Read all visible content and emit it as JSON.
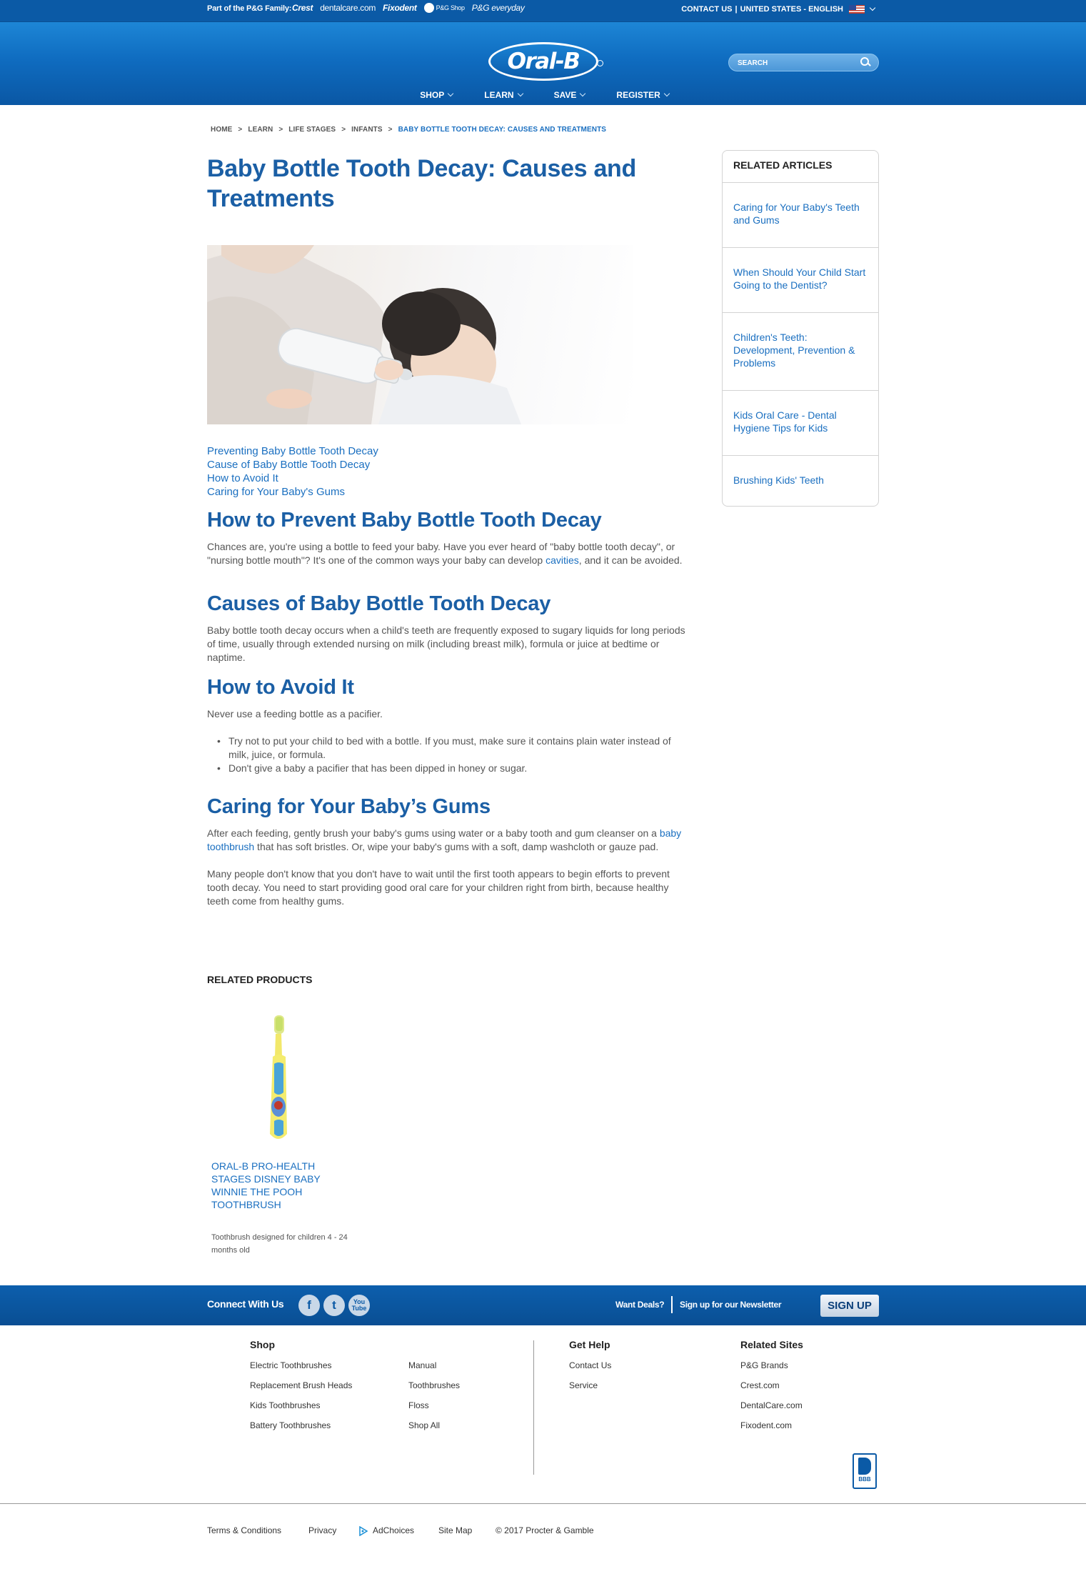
{
  "family_bar": {
    "label": "Part of the P&G Family:",
    "brands": [
      "Crest",
      "dentalcare.com",
      "Fixodent",
      "P&G Shop",
      "P&G everyday"
    ],
    "contact": "CONTACT US",
    "locale": "UNITED STATES - ENGLISH",
    "separator": "|"
  },
  "header": {
    "logo": "Oral-B",
    "search_placeholder": "SEARCH",
    "nav": [
      "SHOP",
      "LEARN",
      "SAVE",
      "REGISTER"
    ]
  },
  "breadcrumb": [
    "HOME",
    "LEARN",
    "LIFE STAGES",
    "INFANTS",
    "BABY BOTTLE TOOTH DECAY: CAUSES AND TREATMENTS"
  ],
  "breadcrumb_sep": ">",
  "article": {
    "title": "Baby Bottle Tooth Decay: Causes and Treatments",
    "toc": [
      "Preventing Baby Bottle Tooth Decay",
      "Cause of Baby Bottle Tooth Decay",
      "How to Avoid It",
      "Caring for Your Baby's Gums"
    ],
    "s1": {
      "heading": "How to Prevent Baby Bottle Tooth Decay",
      "p_before": "Chances are, you're using a bottle to feed your baby. Have you ever heard of \"baby bottle tooth decay\", or \"nursing bottle mouth\"? It's one of the common ways your baby can develop ",
      "p_link": "cavities",
      "p_after": ", and it can be avoided."
    },
    "s2": {
      "heading": "Causes of Baby Bottle Tooth Decay",
      "p": "Baby bottle tooth decay occurs when a child's teeth are frequently exposed to sugary liquids for long periods of time, usually through extended nursing on milk (including breast milk), formula or juice at bedtime or naptime."
    },
    "s3": {
      "heading": "How to Avoid It",
      "p": "Never use a feeding bottle as a pacifier.",
      "bullets": [
        "Try not to put your child to bed with a bottle. If you must, make sure it contains plain water instead of milk, juice, or formula.",
        "Don't give a baby a pacifier that has been dipped in honey or sugar."
      ]
    },
    "s4": {
      "heading": "Caring for Your Baby’s Gums",
      "p1_before": "After each feeding, gently brush your baby's gums using water or a baby tooth and gum cleanser on a ",
      "p1_link": "baby toothbrush",
      "p1_after": " that has soft bristles. Or, wipe your baby's gums with a soft, damp washcloth or gauze pad.",
      "p2": "Many people don't know that you don't have to wait until the first tooth appears to begin efforts to prevent tooth decay. You need to start providing good oral care for your children right from birth, because healthy teeth come from healthy gums."
    }
  },
  "sidebar": {
    "title": "RELATED ARTICLES",
    "items": [
      "Caring for Your Baby's Teeth and Gums",
      "When Should Your Child Start Going to the Dentist?",
      "Children's Teeth: Development, Prevention & Problems",
      "Kids Oral Care - Dental Hygiene Tips for Kids",
      "Brushing Kids' Teeth"
    ]
  },
  "related_products": {
    "title": "RELATED PRODUCTS",
    "product_name": "ORAL-B PRO-HEALTH STAGES DISNEY BABY WINNIE THE POOH TOOTHBRUSH",
    "product_desc": "Toothbrush designed for children 4 - 24 months old"
  },
  "connect": {
    "label": "Connect With Us",
    "social": {
      "facebook": "f",
      "twitter": "t",
      "youtube_1": "You",
      "youtube_2": "Tube"
    },
    "deals": "Want Deals?",
    "newsletter": "Sign up for our Newsletter",
    "signup": "SIGN UP"
  },
  "footer": {
    "shop_title": "Shop",
    "shop_col1": [
      "Electric Toothbrushes",
      "Replacement Brush Heads",
      "Kids Toothbrushes",
      "Battery Toothbrushes"
    ],
    "shop_col2": [
      "Manual",
      "Toothbrushes",
      "Floss",
      "Shop All"
    ],
    "help_title": "Get Help",
    "help": [
      "Contact Us",
      "Service"
    ],
    "sites_title": "Related Sites",
    "sites": [
      "P&G Brands",
      "Crest.com",
      "DentalCare.com",
      "Fixodent.com"
    ],
    "bbb": "BBB",
    "legal": [
      "Terms & Conditions",
      "Privacy",
      "AdChoices",
      "Site Map",
      "© 2017 Procter & Gamble"
    ]
  },
  "colors": {
    "brand_blue": "#0b5aa6",
    "heading_blue": "#1b5fa5",
    "link_blue": "#1a6fc0",
    "body_text": "#555555"
  }
}
